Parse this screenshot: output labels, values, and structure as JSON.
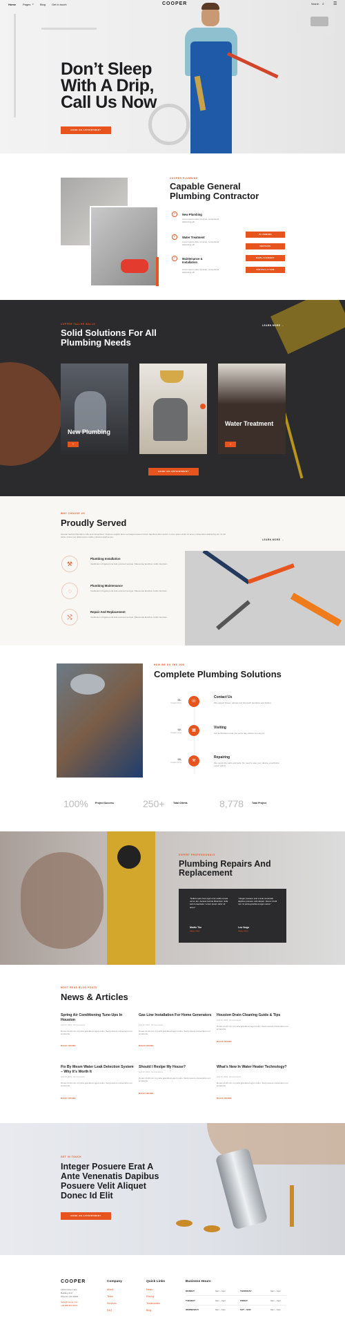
{
  "header": {
    "nav": [
      "Home",
      "Pages",
      "Blog",
      "Get in touch"
    ],
    "logo": "COOPER",
    "search": "Search"
  },
  "hero": {
    "title_lines": [
      "Don’t Sleep",
      "With A Drip,",
      "Call Us Now"
    ],
    "cta": "BOOK AN APPOINTMENT"
  },
  "about": {
    "eyebrow": "COOPER PLUMBING",
    "title_lines": [
      "Capable General",
      "Plumbing Contractor"
    ],
    "services": [
      {
        "title": "New Plumbing",
        "desc": "Lorem ipsum dolor sit amet, consectetur adipiscing elit"
      },
      {
        "title": "Water Treatment",
        "desc": "Lorem ipsum dolor sit amet, consectetur adipiscing elit"
      },
      {
        "title": "Maintenance & Installation",
        "desc": "Lorem ipsum dolor sit amet, consectetur adipiscing elit"
      }
    ],
    "buttons": [
      "PLUMBING",
      "REPAIRS",
      "REPLACEMENT",
      "INSTALLATION"
    ]
  },
  "solutions": {
    "eyebrow": "COPPER TALLER WALLS",
    "title_lines": [
      "Solid Solutions For All",
      "Plumbing Needs"
    ],
    "learn_more": "LEARN MORE",
    "cards": [
      {
        "title": "New Plumbing"
      },
      {
        "title": "Water Treatment"
      }
    ],
    "cta": "BOOK AN APPOINTMENT"
  },
  "served": {
    "eyebrow": "WHY CHOOSE US",
    "title": "Proudly Served",
    "desc": "Aenean lacinia bibendum nulla sed consectetur. Vivamus sagittis lacus vel augue laoreet rutrum faucibus dolor auctor. Lorem ipsum dolor sit amet, consectetur adipiscing elit. Ut elit tellus, luctus nec ullamcorper mattis, pulvinar dapibus leo.",
    "learn_more": "LEARN MORE",
    "items": [
      {
        "title": "Plumbing Installation",
        "desc": "Vestibulum id ligula porta felis euismod semper. Maecenas faucibus mollis interdum."
      },
      {
        "title": "Plumbing Maintenance",
        "desc": "Vestibulum id ligula porta felis euismod semper. Maecenas faucibus mollis interdum."
      },
      {
        "title": "Repair And Replacement",
        "desc": "Vestibulum id ligula porta felis euismod semper. Maecenas faucibus mollis interdum."
      }
    ]
  },
  "process": {
    "eyebrow": "HOW WE DO THE JOB",
    "title": "Complete Plumbing Solutions",
    "steps": [
      {
        "num": "01.",
        "label": "Cooper Corp.",
        "title": "Contact Us",
        "desc": "We support house, garage and domestic plumbers and boilers."
      },
      {
        "num": "02.",
        "label": "Cooper Corp.",
        "title": "Visiting",
        "desc": "Our technicians meet you same day, deliver you any fix."
      },
      {
        "num": "03.",
        "label": "Cooper Corp.",
        "title": "Repairing",
        "desc": "We supply the parts and tools. No need to step your device, a technical expert will fix."
      }
    ],
    "stats": [
      {
        "value": "100%",
        "label": "Project Success"
      },
      {
        "value": "250+",
        "label": "Total Clients"
      },
      {
        "value": "8,778",
        "label": "Total Project"
      }
    ]
  },
  "repairs": {
    "eyebrow": "EXPERT PROFESSIONALS",
    "title_lines": [
      "Plumbing Repairs And",
      "Replacement"
    ],
    "quotes": [
      {
        "text": "“Nullam quis risus eget urna mollis ornare vel eu leo. Aenean lacinia bibendum nulla sed consectetur. Lorem ipsum dolor sit amet.”",
        "name": "Martin Tim",
        "role": "Happy Client"
      },
      {
        "text": "“Integer posuere erat a ante venenatis dapibus posuere velit aliquet. Donec id elit non mi porta gravida at eget metus.”",
        "name": "Lea Vargo",
        "role": "Happy Client"
      }
    ]
  },
  "news": {
    "eyebrow": "MOST READ BLOG POSTS",
    "title": "News & Articles",
    "read_more": "READ MORE",
    "posts": [
      {
        "title": "Spring Air Conditioning Tune-Ups In Houston",
        "meta": "April 15, 2022 · No Comments",
        "desc": "Donec id elit non mi porta gravida at eget metus. Sed posuere consectetur est at lobortis."
      },
      {
        "title": "Gas Line Installation For Home Generators",
        "meta": "April 15, 2022 · No Comments",
        "desc": "Donec id elit non mi porta gravida at eget metus. Sed posuere consectetur est at lobortis."
      },
      {
        "title": "Houston Drain Cleaning Guide & Tips",
        "meta": "April 15, 2022 · No Comments",
        "desc": "Donec id elit non mi porta gravida at eget metus. Sed posuere consectetur est at lobortis."
      },
      {
        "title": "Fix By Mesm Water Leak Detection System – Why It’s Worth It",
        "meta": "April 15, 2022 · No Comments",
        "desc": "Donec id elit non mi porta gravida at eget metus. Sed posuere consectetur est at lobortis."
      },
      {
        "title": "Should I Reslpe My House?",
        "meta": "April 15, 2022 · No Comments",
        "desc": "Donec id elit non mi porta gravida at eget metus. Sed posuere consectetur est at lobortis."
      },
      {
        "title": "What’s New In Water Heater Technology?",
        "meta": "April 15, 2022 · No Comments",
        "desc": "Donec id elit non mi porta gravida at eget metus. Sed posuere consectetur est at lobortis."
      }
    ]
  },
  "cta": {
    "eyebrow": "GET IN TOUCH",
    "title_lines": [
      "Integer Posuere Erat A",
      "Ante Venenatis Dapibus",
      "Posuere Velit Aliquet",
      "Donec Id Elit"
    ],
    "button": "BOOK AN APPOINTMENT"
  },
  "footer": {
    "logo": "COOPER",
    "address": [
      "1424 Cotton Lane",
      "Building 213",
      "Phoenix, AZ 33902"
    ],
    "email": "hello@cooper.com",
    "phone": "+00 888 550 5878",
    "company": {
      "title": "Company",
      "links": [
        "About",
        "Team",
        "Services",
        "FAQ"
      ]
    },
    "quick": {
      "title": "Quick Links",
      "links": [
        "News",
        "Pricing",
        "Testimonials",
        "Blog"
      ]
    },
    "hours": {
      "title": "Business Hours",
      "rows": [
        {
          "day": "MONDAY",
          "time": "9am – 6pm"
        },
        {
          "day": "TUESDAY",
          "time": "9am – 6pm"
        },
        {
          "day": "WEDNESDAY",
          "time": "9am – 6pm"
        },
        {
          "day": "THURSDAY",
          "time": "9am – 6pm"
        },
        {
          "day": "FRIDAY",
          "time": "9am – 6pm"
        },
        {
          "day": "SAT – SUN",
          "time": "9am – 6pm"
        }
      ]
    }
  },
  "colors": {
    "accent": "#e8541e",
    "dark": "#2b2b2d"
  }
}
